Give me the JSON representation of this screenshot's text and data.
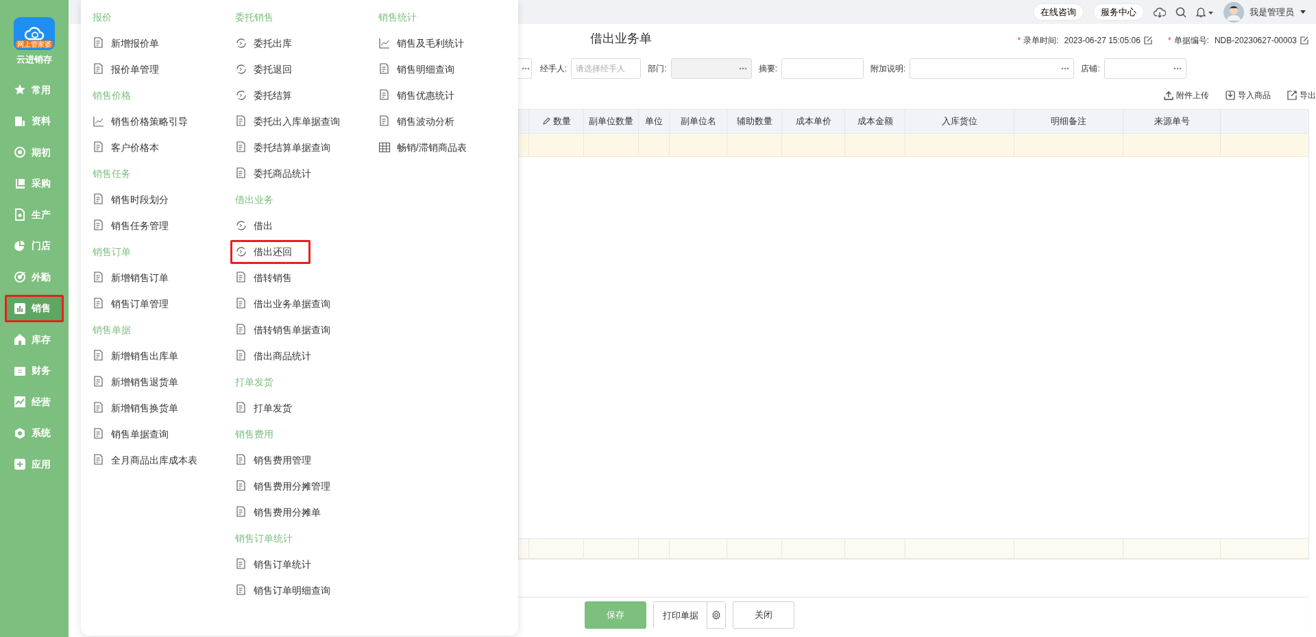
{
  "sidebar": {
    "logo_badge": "网上管家婆",
    "app_name": "云进销存",
    "items": [
      {
        "label": "常用",
        "selected": false,
        "highlighted": false
      },
      {
        "label": "资料",
        "selected": false,
        "highlighted": false
      },
      {
        "label": "期初",
        "selected": false,
        "highlighted": false
      },
      {
        "label": "采购",
        "selected": false,
        "highlighted": false
      },
      {
        "label": "生产",
        "selected": false,
        "highlighted": false
      },
      {
        "label": "门店",
        "selected": false,
        "highlighted": false
      },
      {
        "label": "外勤",
        "selected": false,
        "highlighted": false
      },
      {
        "label": "销售",
        "selected": true,
        "highlighted": true
      },
      {
        "label": "库存",
        "selected": false,
        "highlighted": false
      },
      {
        "label": "财务",
        "selected": false,
        "highlighted": false
      },
      {
        "label": "经营",
        "selected": false,
        "highlighted": false
      },
      {
        "label": "系统",
        "selected": false,
        "highlighted": false
      },
      {
        "label": "应用",
        "selected": false,
        "highlighted": false
      }
    ]
  },
  "topbar": {
    "buttons": [
      "在线咨询",
      "服务中心"
    ],
    "user": "我是管理员"
  },
  "mega_menu": {
    "columns": [
      {
        "sections": [
          {
            "title": "报价",
            "items": [
              {
                "label": "新增报价单",
                "highlighted": false
              },
              {
                "label": "报价单管理",
                "highlighted": false
              }
            ]
          },
          {
            "title": "销售价格",
            "items": [
              {
                "label": "销售价格策略引导",
                "highlighted": false
              },
              {
                "label": "客户价格本",
                "highlighted": false
              }
            ]
          },
          {
            "title": "销售任务",
            "items": [
              {
                "label": "销售时段划分",
                "highlighted": false
              },
              {
                "label": "销售任务管理",
                "highlighted": false
              }
            ]
          },
          {
            "title": "销售订单",
            "items": [
              {
                "label": "新增销售订单",
                "highlighted": false
              },
              {
                "label": "销售订单管理",
                "highlighted": false
              }
            ]
          },
          {
            "title": "销售单据",
            "items": [
              {
                "label": "新增销售出库单",
                "highlighted": false
              },
              {
                "label": "新增销售退货单",
                "highlighted": false
              },
              {
                "label": "新增销售换货单",
                "highlighted": false
              },
              {
                "label": "销售单据查询",
                "highlighted": false
              },
              {
                "label": "全月商品出库成本表",
                "highlighted": false
              }
            ]
          }
        ]
      },
      {
        "sections": [
          {
            "title": "委托销售",
            "items": [
              {
                "label": "委托出库",
                "highlighted": false
              },
              {
                "label": "委托退回",
                "highlighted": false
              },
              {
                "label": "委托结算",
                "highlighted": false
              },
              {
                "label": "委托出入库单据查询",
                "highlighted": false
              },
              {
                "label": "委托结算单据查询",
                "highlighted": false
              },
              {
                "label": "委托商品统计",
                "highlighted": false
              }
            ]
          },
          {
            "title": "借出业务",
            "items": [
              {
                "label": "借出",
                "highlighted": false
              },
              {
                "label": "借出还回",
                "highlighted": true
              },
              {
                "label": "借转销售",
                "highlighted": false
              },
              {
                "label": "借出业务单据查询",
                "highlighted": false
              },
              {
                "label": "借转销售单据查询",
                "highlighted": false
              },
              {
                "label": "借出商品统计",
                "highlighted": false
              }
            ]
          },
          {
            "title": "打单发货",
            "items": [
              {
                "label": "打单发货",
                "highlighted": false
              }
            ]
          },
          {
            "title": "销售费用",
            "items": [
              {
                "label": "销售费用管理",
                "highlighted": false
              },
              {
                "label": "销售费用分摊管理",
                "highlighted": false
              },
              {
                "label": "销售费用分摊单",
                "highlighted": false
              }
            ]
          },
          {
            "title": "销售订单统计",
            "items": [
              {
                "label": "销售订单统计",
                "highlighted": false
              },
              {
                "label": "销售订单明细查询",
                "highlighted": false
              }
            ]
          }
        ]
      },
      {
        "sections": [
          {
            "title": "销售统计",
            "items": [
              {
                "label": "销售及毛利统计",
                "highlighted": false
              },
              {
                "label": "销售明细查询",
                "highlighted": false
              },
              {
                "label": "销售优惠统计",
                "highlighted": false
              },
              {
                "label": "销售波动分析",
                "highlighted": false
              },
              {
                "label": "畅销/滞销商品表",
                "highlighted": false
              }
            ]
          }
        ]
      }
    ]
  },
  "form": {
    "title": "借出业务单",
    "meta": [
      {
        "mark": "*",
        "label": "录单时间:",
        "value": "2023-06-27 15:05:06"
      },
      {
        "mark": "*",
        "label": "单据编号:",
        "value": "NDB-20230627-00003"
      }
    ],
    "fields": [
      {
        "picker": true,
        "disabled": false
      },
      {
        "label": "经手人:",
        "placeholder": "请选择经手人",
        "picker": false,
        "disabled": false
      },
      {
        "label": "部门:",
        "picker": true,
        "disabled": true
      },
      {
        "label": "摘要:",
        "picker": false,
        "disabled": false
      },
      {
        "label": "附加说明:",
        "picker": true,
        "disabled": false
      },
      {
        "label": "店铺:",
        "picker": true,
        "disabled": false
      }
    ]
  },
  "toolbar": [
    "附件上传",
    "导入商品",
    "导出"
  ],
  "table": {
    "columns": [
      {
        "label": "数量",
        "editable": true
      },
      {
        "label": "副单位数量",
        "editable": false
      },
      {
        "label": "单位",
        "editable": false
      },
      {
        "label": "副单位名",
        "editable": false
      },
      {
        "label": "辅助数量",
        "editable": false
      },
      {
        "label": "成本单价",
        "editable": false
      },
      {
        "label": "成本金额",
        "editable": false
      },
      {
        "label": "入库货位",
        "editable": false
      },
      {
        "label": "明细备注",
        "editable": false
      },
      {
        "label": "来源单号",
        "editable": false
      }
    ]
  },
  "buttons": [
    {
      "label": "保存",
      "kind": "primary"
    },
    {
      "label": "打印单据",
      "kind": "split"
    },
    {
      "label": "关闭",
      "kind": "default"
    }
  ]
}
